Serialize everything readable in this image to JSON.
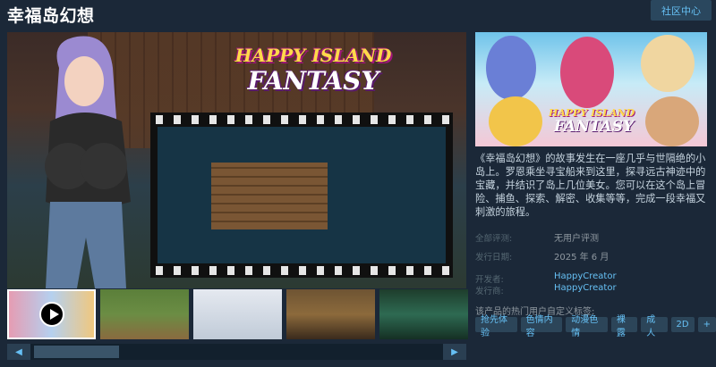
{
  "header": {
    "title": "幸福岛幻想",
    "community_hub": "社区中心"
  },
  "media": {
    "logo_line1": "HAPPY ISLAND",
    "logo_line2": "FANTASY",
    "thumbnails": [
      {
        "label": "video",
        "selected": true
      },
      {
        "label": "screenshot-farm",
        "selected": false
      },
      {
        "label": "screenshot-menu",
        "selected": false
      },
      {
        "label": "screenshot-room",
        "selected": false
      },
      {
        "label": "screenshot-cave",
        "selected": false
      }
    ],
    "scroll_left": "◀",
    "scroll_right": "▶"
  },
  "capsule": {
    "logo_line1": "HAPPY ISLAND",
    "logo_line2": "FANTASY"
  },
  "description": "《幸福岛幻想》的故事发生在一座几乎与世隔绝的小岛上。罗恩乘坐寻宝船来到这里，探寻远古神迹中的宝藏，并结识了岛上几位美女。您可以在这个岛上冒险、捕鱼、探索、解密、收集等等，完成一段幸福又刺激的旅程。",
  "info": {
    "reviews_label": "全部评测:",
    "reviews_value": "无用户评测",
    "release_label": "发行日期:",
    "release_value": "2025 年 6 月",
    "developer_label": "开发者:",
    "developer_value": "HappyCreator",
    "publisher_label": "发行商:",
    "publisher_value": "HappyCreator"
  },
  "tags": {
    "label": "该产品的热门用户自定义标签:",
    "items": [
      "抢先体验",
      "色情内容",
      "动漫色情",
      "裸露",
      "成人",
      "2D",
      "+"
    ]
  },
  "colors": {
    "background": "#1b2838",
    "link": "#66c0f4",
    "tag_bg": "#2c4559"
  }
}
